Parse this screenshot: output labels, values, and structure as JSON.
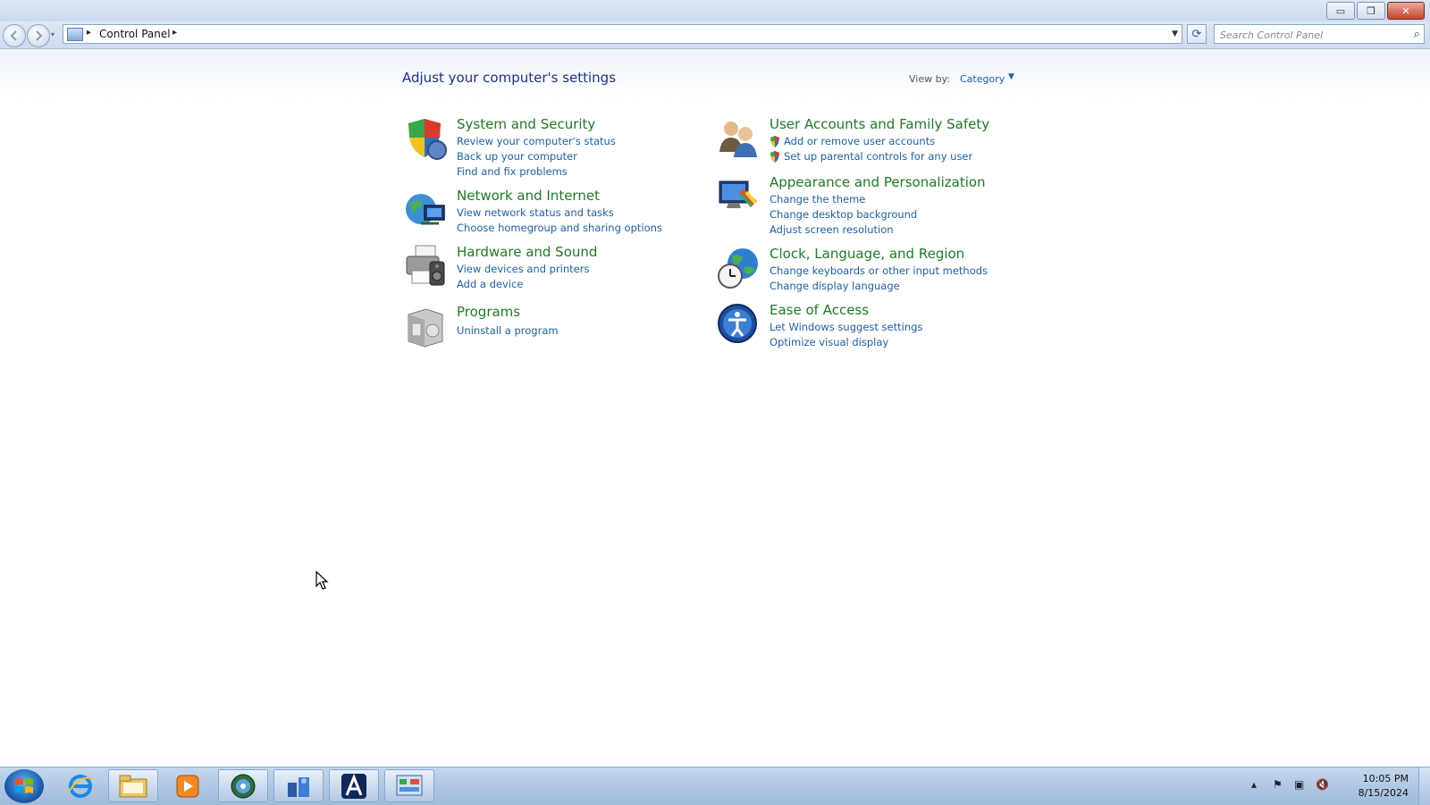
{
  "window": {
    "caption_buttons": {
      "minimize": "▭",
      "restore": "❐",
      "close": "✕"
    }
  },
  "address_bar": {
    "breadcrumb": [
      "Control Panel"
    ],
    "search_placeholder": "Search Control Panel"
  },
  "main": {
    "title": "Adjust your computer's settings",
    "view_by_label": "View by:",
    "view_by_value": "Category"
  },
  "categories": [
    {
      "title": "System and Security",
      "icon": "shield-icon",
      "links": [
        "Review your computer's status",
        "Back up your computer",
        "Find and fix problems"
      ]
    },
    {
      "title": "Network and Internet",
      "icon": "network-globe-icon",
      "links": [
        "View network status and tasks",
        "Choose homegroup and sharing options"
      ]
    },
    {
      "title": "Hardware and Sound",
      "icon": "printer-speaker-icon",
      "links": [
        "View devices and printers",
        "Add a device"
      ]
    },
    {
      "title": "Programs",
      "icon": "programs-box-icon",
      "links": [
        "Uninstall a program"
      ]
    },
    {
      "title": "User Accounts and Family Safety",
      "icon": "users-icon",
      "links": [
        "Add or remove user accounts",
        "Set up parental controls for any user"
      ]
    },
    {
      "title": "Appearance and Personalization",
      "icon": "monitor-paint-icon",
      "links": [
        "Change the theme",
        "Change desktop background",
        "Adjust screen resolution"
      ]
    },
    {
      "title": "Clock, Language, and Region",
      "icon": "clock-globe-icon",
      "links": [
        "Change keyboards or other input methods",
        "Change display language"
      ]
    },
    {
      "title": "Ease of Access",
      "icon": "ease-of-access-icon",
      "links": [
        "Let Windows suggest settings",
        "Optimize visual display"
      ]
    }
  ],
  "taskbar": {
    "pinned": [
      "internet-explorer-icon",
      "file-explorer-icon",
      "media-player-icon",
      "network-browser-icon",
      "system-tool-icon",
      "a-app-icon",
      "control-panel-icon"
    ],
    "clock": {
      "time": "10:05 PM",
      "date": "8/15/2024"
    }
  },
  "colors": {
    "category_title": "#1e7a25",
    "link": "#1e5fa8",
    "page_title": "#1e3287"
  }
}
